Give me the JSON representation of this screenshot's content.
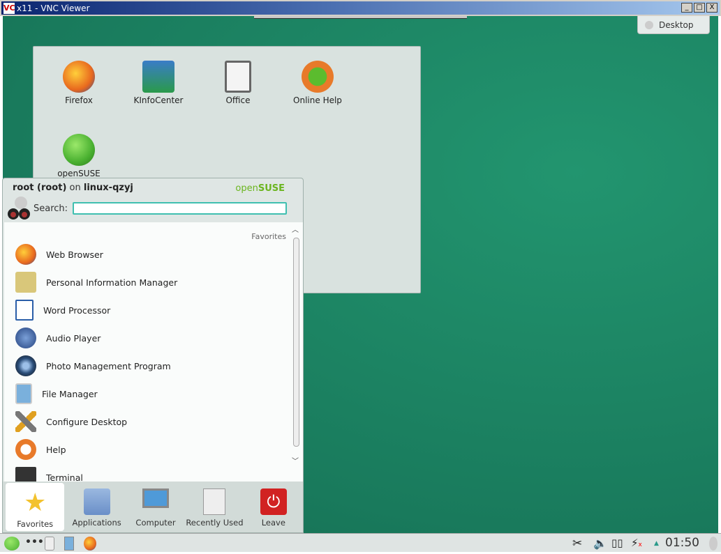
{
  "window": {
    "title": "x11 - VNC Viewer",
    "logo": "VC",
    "buttons": [
      "_",
      "□",
      "X"
    ]
  },
  "desktop": {
    "desktop_button": "Desktop",
    "icons": [
      {
        "label": "Firefox",
        "color": "#e8681e"
      },
      {
        "label": "KInfoCenter",
        "color": "#3a7cc7"
      },
      {
        "label": "Office",
        "color": "#888"
      },
      {
        "label": "Online Help",
        "color": "#5bbc2e"
      },
      {
        "label": "openSUSE",
        "color": "#49b030"
      }
    ]
  },
  "menu": {
    "user": "root (root)",
    "on": "on",
    "host": "linux-qzyj",
    "brand_open": "open",
    "brand_suse": "SUSE",
    "search_label": "Search:",
    "search_value": "",
    "section": "Favorites",
    "items": [
      {
        "label": "Web Browser",
        "color": "#e8681e"
      },
      {
        "label": "Personal Information Manager",
        "color": "#d9c77a"
      },
      {
        "label": "Word Processor",
        "color": "#2a5ea8"
      },
      {
        "label": "Audio Player",
        "color": "#24427e"
      },
      {
        "label": "Photo Management Program",
        "color": "#2b4e7a"
      },
      {
        "label": "File Manager",
        "color": "#7ab0dc"
      },
      {
        "label": "Configure Desktop",
        "color": "#777"
      },
      {
        "label": "Help",
        "color": "#e87a2a"
      },
      {
        "label": "Terminal",
        "color": "#333"
      }
    ],
    "tabs": [
      {
        "label": "Favorites",
        "color": "#f3c22e"
      },
      {
        "label": "Applications",
        "color": "#6a8fc8"
      },
      {
        "label": "Computer",
        "color": "#4f9ad8"
      },
      {
        "label": "Recently Used",
        "color": "#ddd"
      },
      {
        "label": "Leave",
        "color": "#d12222"
      }
    ]
  },
  "taskbar": {
    "clock": "01:50"
  }
}
